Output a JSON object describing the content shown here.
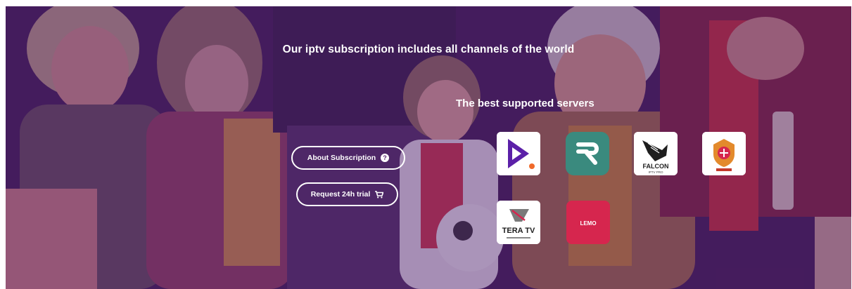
{
  "section": {
    "headline": "Our iptv subscription includes all channels of the world",
    "servers_title": "The best supported servers"
  },
  "buttons": {
    "about_label": "About Subscription",
    "about_icon": "question-circle-icon",
    "trial_label": "Request 24h trial",
    "trial_icon": "shopping-cart-icon"
  },
  "logos": {
    "falcon_text": "FALCON",
    "falcon_sub": "IPTV PRO",
    "tera_text": "TERA TV",
    "lemo_text": "LEMO"
  },
  "colors": {
    "overlay": "#541e78",
    "accent_purple": "#5b20a8",
    "teal": "#3a8a7e",
    "pink_red": "#d6264e"
  }
}
